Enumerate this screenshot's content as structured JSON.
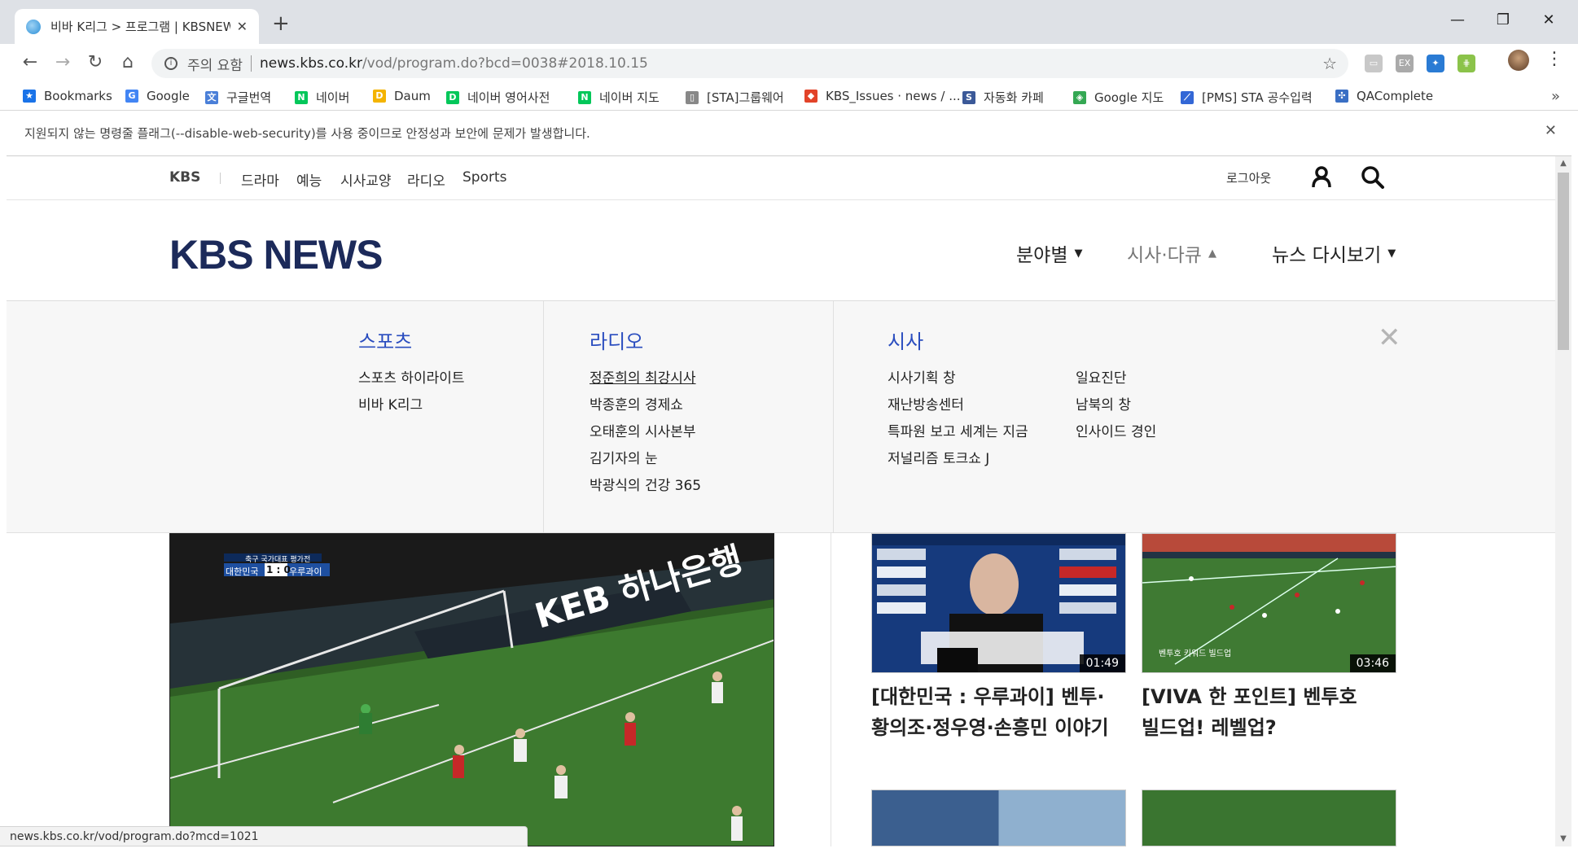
{
  "browser": {
    "tab_title": "비바 K리그 > 프로그램 | KBSNEWS",
    "tab_close": "✕",
    "new_tab": "+",
    "window_controls": {
      "minimize": "—",
      "maximize": "❐",
      "close": "✕"
    },
    "url_warning": "주의 요함",
    "url_host": "news.kbs.co.kr",
    "url_path": "/vod/program.do?bcd=0038#2018.10.15",
    "menu_glyph": "⋮"
  },
  "bookmarks": [
    {
      "label": "Bookmarks",
      "icon": "star-icon",
      "color": "#1a73e8",
      "glyph": "★"
    },
    {
      "label": "Google",
      "icon": "google-icon",
      "color": "#4285f4",
      "glyph": "G"
    },
    {
      "label": "구글번역",
      "icon": "translate-icon",
      "color": "#4a7fd8",
      "glyph": "文"
    },
    {
      "label": "네이버",
      "icon": "naver-icon",
      "color": "#03c75a",
      "glyph": "N"
    },
    {
      "label": "Daum",
      "icon": "daum-icon",
      "color": "#f4b400",
      "glyph": "D"
    },
    {
      "label": "네이버 영어사전",
      "icon": "dictionary-icon",
      "color": "#03c75a",
      "glyph": "D"
    },
    {
      "label": "네이버 지도",
      "icon": "naver-map-icon",
      "color": "#03c75a",
      "glyph": "N"
    },
    {
      "label": "[STA]그룹웨어",
      "icon": "page-icon",
      "color": "#888888",
      "glyph": "▯"
    },
    {
      "label": "KBS_Issues · news / ...",
      "icon": "gitlab-icon",
      "color": "#e24329",
      "glyph": "◆"
    },
    {
      "label": "자동화 카페",
      "icon": "cafe-icon",
      "color": "#3b5998",
      "glyph": "S"
    },
    {
      "label": "Google 지도",
      "icon": "google-maps-icon",
      "color": "#34a853",
      "glyph": "◈"
    },
    {
      "label": "[PMS] STA 공수입력",
      "icon": "pms-icon",
      "color": "#3367d6",
      "glyph": "⟋"
    },
    {
      "label": "QAComplete",
      "icon": "qacomplete-icon",
      "color": "#3a6fc4",
      "glyph": "✣"
    }
  ],
  "bookmarks_more": "»",
  "infobar": {
    "text": "지원되지 않는 명령줄 플래그(--disable-web-security)를 사용 중이므로 안정성과 보안에 문제가 발생합니다.",
    "close": "✕"
  },
  "gnb": {
    "items": [
      "KBS",
      "드라마",
      "예능",
      "시사교양",
      "라디오",
      "Sports"
    ],
    "logout": "로그아웃"
  },
  "header": {
    "logo": "KBS NEWS",
    "nav": [
      {
        "label": "분야별",
        "arrow": "▼",
        "active": false
      },
      {
        "label": "시사·다큐",
        "arrow": "▲",
        "active": true
      },
      {
        "label": "뉴스 다시보기",
        "arrow": "▼",
        "active": false
      }
    ]
  },
  "dropdown": {
    "columns": [
      {
        "heading": "스포츠",
        "links": [
          "스포츠 하이라이트",
          "비바 K리그"
        ]
      },
      {
        "heading": "라디오",
        "links": [
          "정준희의 최강시사",
          "박종훈의 경제쇼",
          "오태훈의 시사본부",
          "김기자의 눈",
          "박광식의 건강 365"
        ]
      },
      {
        "heading": "시사",
        "links": [
          "시사기획 창",
          "재난방송센터",
          "특파원 보고 세계는 지금",
          "저널리즘 토크쇼 J",
          "일요진단",
          "남북의 창",
          "인사이드 경인"
        ]
      }
    ],
    "close": "✕"
  },
  "videos": {
    "main_overlay": {
      "caption": "축구 국가대표 평가전",
      "team_a": "대한민국",
      "score": "1 : 0",
      "team_b": "우루과이",
      "ad_text": "KEB 하나은행"
    },
    "items": [
      {
        "duration": "01:49",
        "title_line1": "[대한민국 : 우루과이] 벤투·",
        "title_line2": "황의조·정우영·손흥민 이야기"
      },
      {
        "duration": "03:46",
        "title_line1": "[VIVA 한 포인트] 벤투호",
        "title_line2": "빌드업! 레벨업?",
        "overlay": "벤투호 키워드 빌드업"
      }
    ]
  },
  "statusbar": "news.kbs.co.kr/vod/program.do?mcd=1021"
}
